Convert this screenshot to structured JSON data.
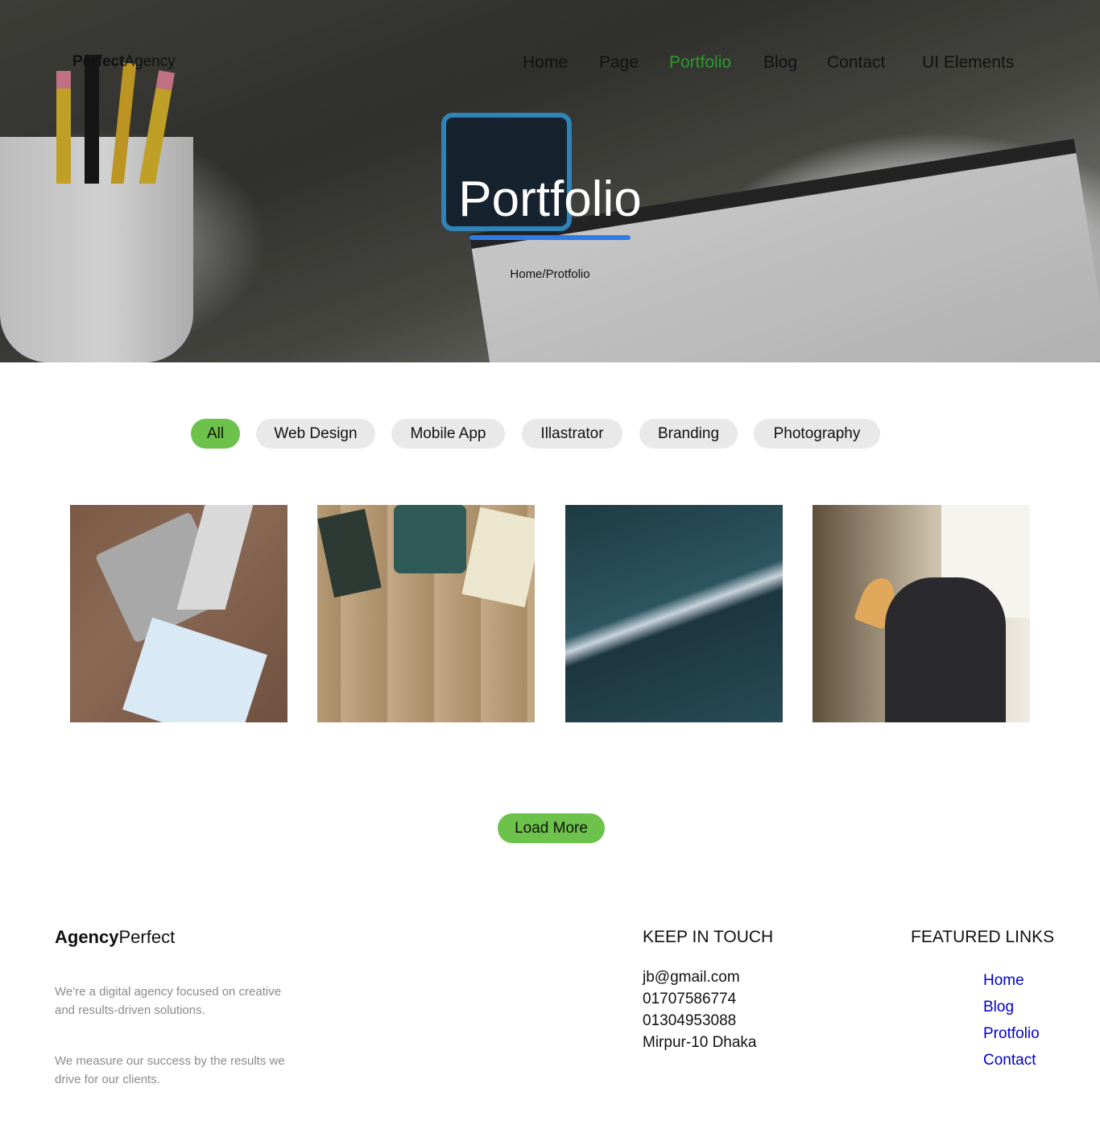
{
  "header": {
    "logo_bold": "Perfect",
    "logo_light": "Agency",
    "nav": [
      {
        "label": "Home",
        "active": false
      },
      {
        "label": "Page",
        "active": false
      },
      {
        "label": "Portfolio",
        "active": true
      },
      {
        "label": "Blog",
        "active": false
      },
      {
        "label": "Contact",
        "active": false
      },
      {
        "label": "UI Elements",
        "active": false
      }
    ]
  },
  "hero": {
    "title": "Portfolio",
    "breadcrumb": "Home/Protfolio",
    "underline_color": "#2f7be6"
  },
  "filters": [
    "All",
    "Web Design",
    "Mobile App",
    "Illastrator",
    "Branding",
    "Photography"
  ],
  "filters_active": "All",
  "accent_color": "#6cc24a",
  "active_nav_color": "#2a9d2a",
  "gallery": [
    {
      "name": "laptop-desk-photo"
    },
    {
      "name": "typewriter-desk-photo"
    },
    {
      "name": "skyscrapers-photo"
    },
    {
      "name": "person-at-desk-photo"
    }
  ],
  "load_more": "Load More",
  "footer": {
    "brand_bold": "Agency",
    "brand_light": "Perfect",
    "text1": "We're a digital agency focused on creative and results-driven solutions.",
    "text2": "We measure our success by the results we drive for our clients.",
    "keep_in_touch_title": "KEEP IN TOUCH",
    "contacts": [
      "jb@gmail.com",
      "01707586774",
      "01304953088",
      "Mirpur-10 Dhaka"
    ],
    "featured_links_title": "FEATURED LINKS",
    "links": [
      "Home",
      "Blog",
      "Protfolio",
      "Contact"
    ],
    "link_color": "#0000cc"
  }
}
